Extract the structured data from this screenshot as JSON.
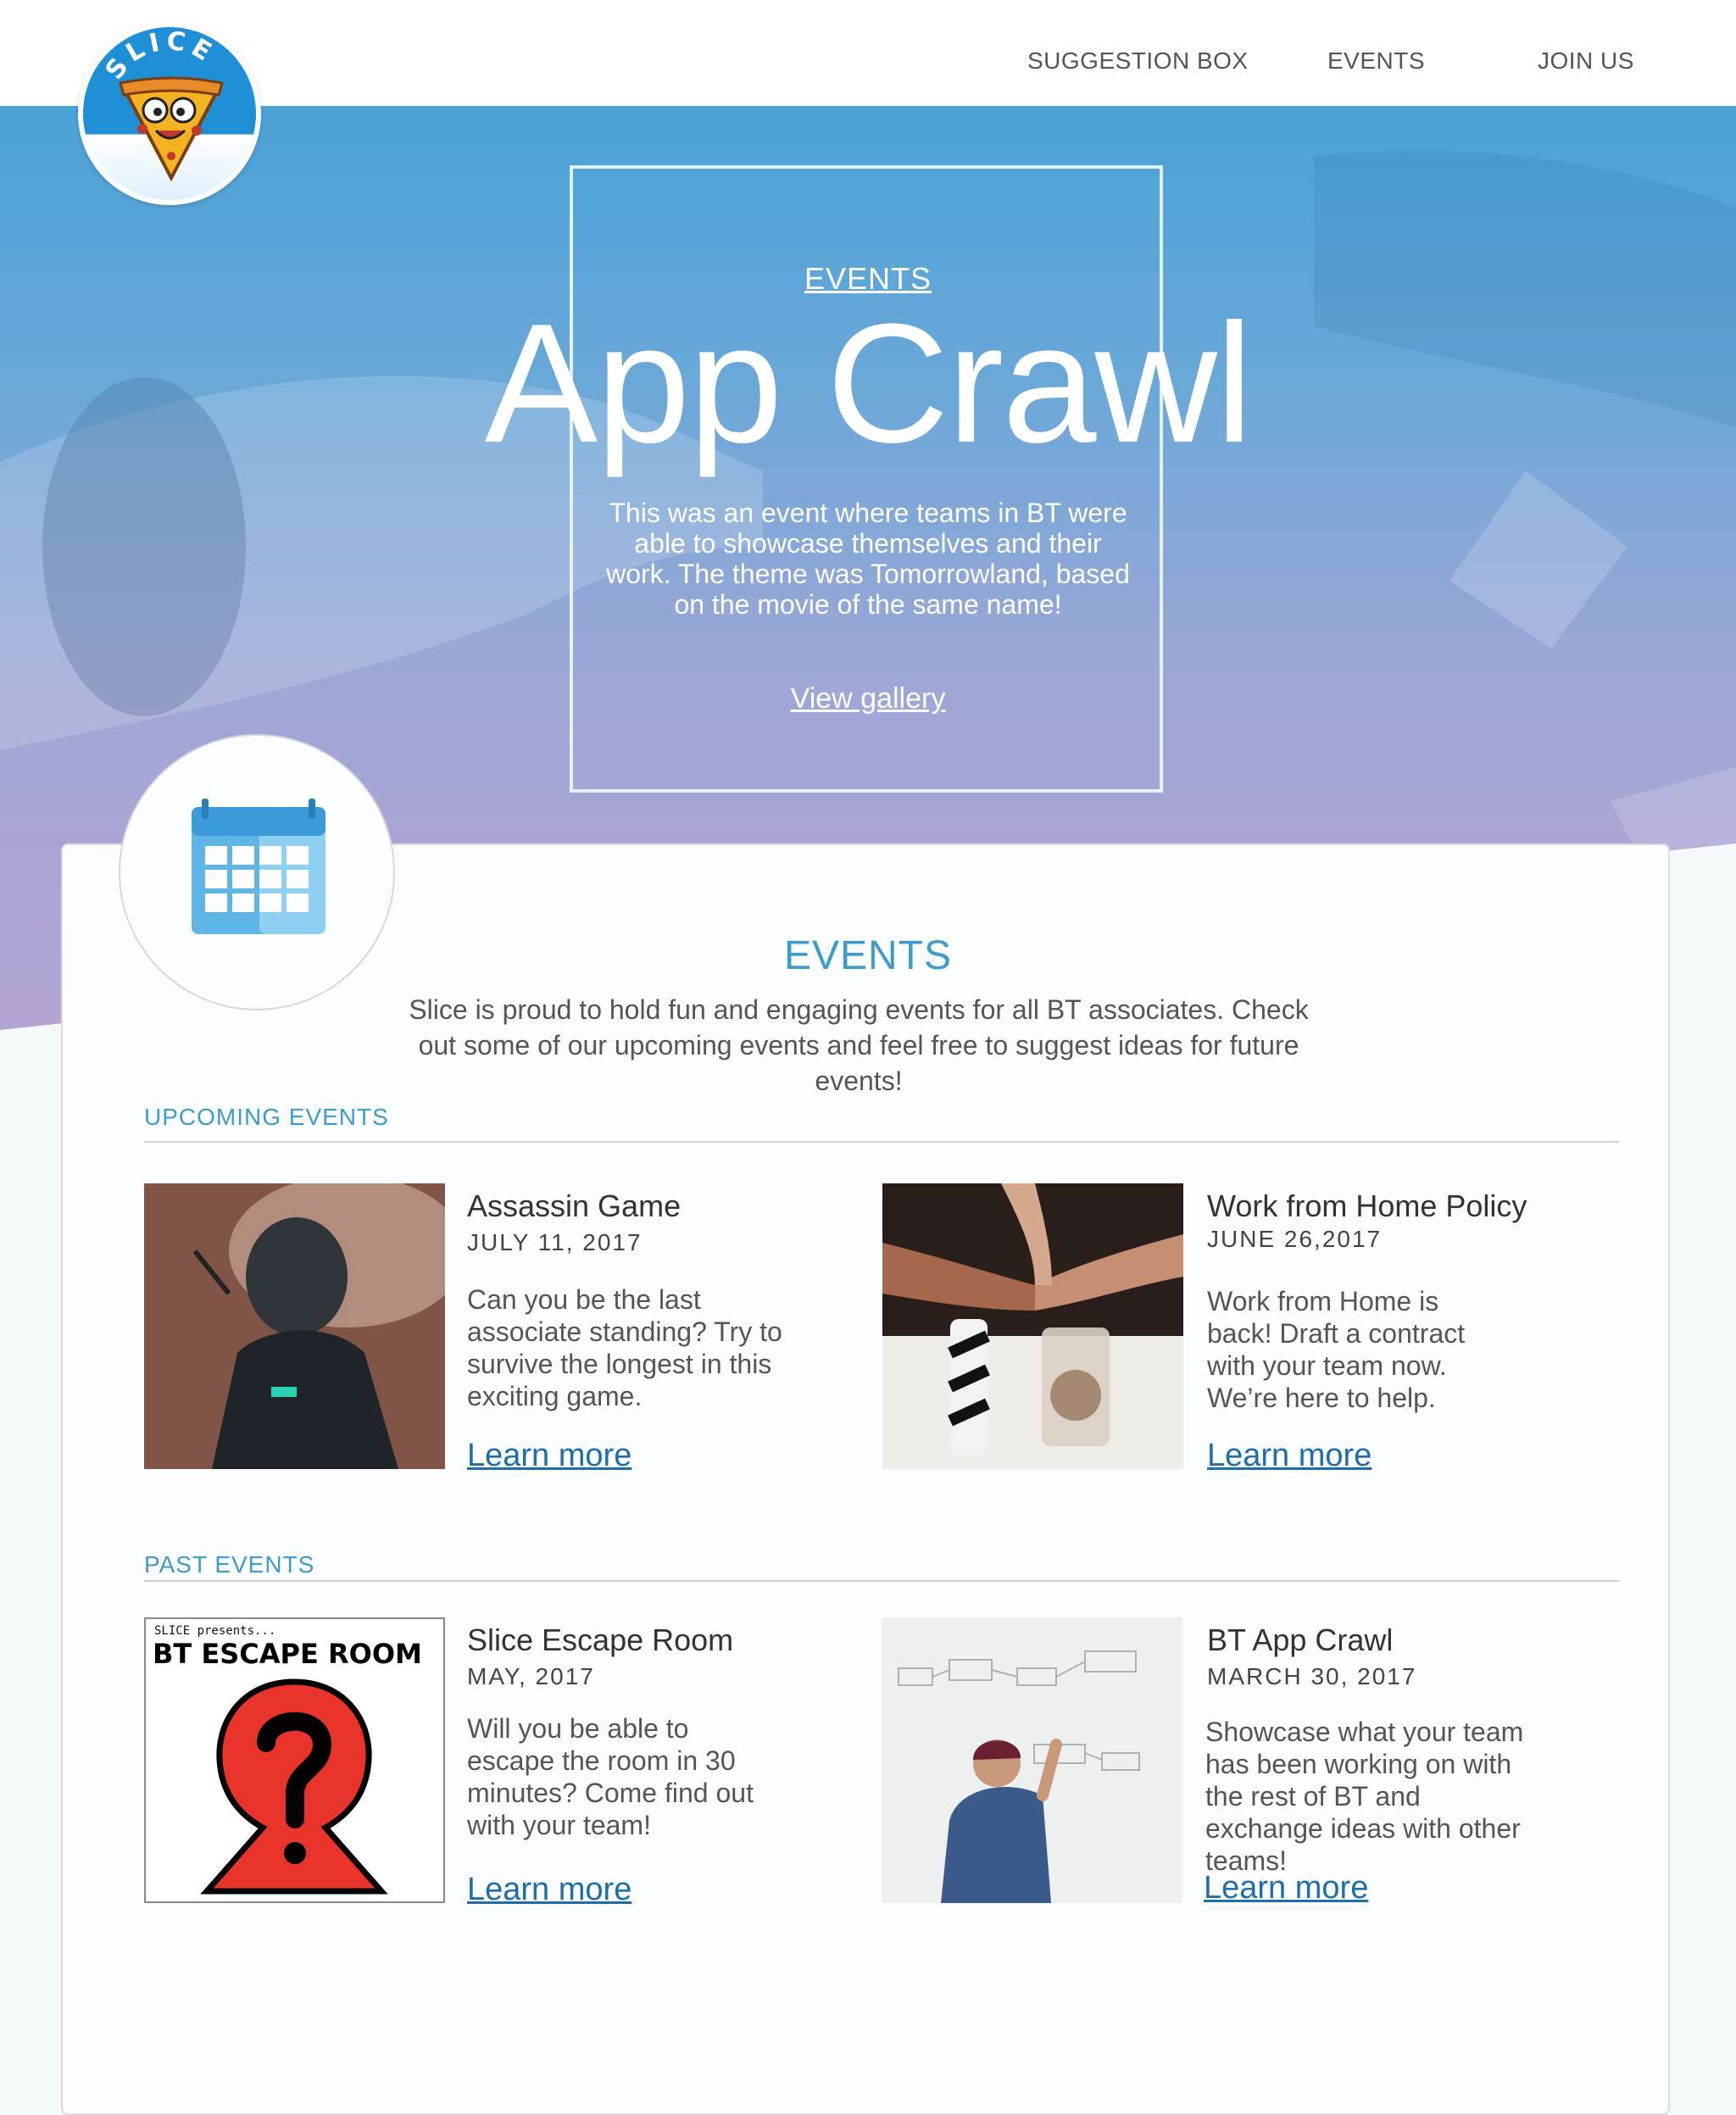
{
  "brand": {
    "logo_text": "SLICE"
  },
  "nav": {
    "items": [
      {
        "label": "SUGGESTION BOX"
      },
      {
        "label": "EVENTS"
      },
      {
        "label": "JOIN US"
      }
    ]
  },
  "hero": {
    "eyebrow": "EVENTS",
    "title": "App Crawl",
    "description": "This was an event where teams in BT were able to showcase themselves and their work. The theme was Tomorrowland, based on the movie of the same name!",
    "link": "View gallery"
  },
  "events_section": {
    "title": "EVENTS",
    "intro": "Slice is proud to hold fun and engaging events for all BT associates. Check out some of our upcoming events and feel free to suggest ideas for future events!",
    "upcoming_heading": "UPCOMING EVENTS",
    "past_heading": "PAST EVENTS"
  },
  "upcoming": [
    {
      "title": "Assassin Game",
      "date": "JULY 11, 2017",
      "description": "Can you be the last associate standing? Try to survive the longest in this exciting game.",
      "link": "Learn more"
    },
    {
      "title": "Work from Home Policy",
      "date": "JUNE 26,2017",
      "description": "Work from Home is back! Draft a contract with your team now. We’re here to help.",
      "link": "Learn more"
    }
  ],
  "past": [
    {
      "title": "Slice Escape Room",
      "date": "MAY, 2017",
      "description": "Will you be able to escape the room in 30 minutes? Come find out with your team!",
      "link": "Learn more",
      "poster_small": "SLICE presents...",
      "poster_title": "BT ESCAPE ROOM"
    },
    {
      "title": "BT App Crawl",
      "date": "MARCH 30, 2017",
      "description": "Showcase what your team has been working on with the rest of BT and exchange ideas with other teams!",
      "link": "Learn more"
    }
  ],
  "colors": {
    "accent": "#3d9ccc",
    "link": "#1e6fa8",
    "hero_top": "#4aa2d6",
    "hero_bottom": "#b3a3d2"
  }
}
